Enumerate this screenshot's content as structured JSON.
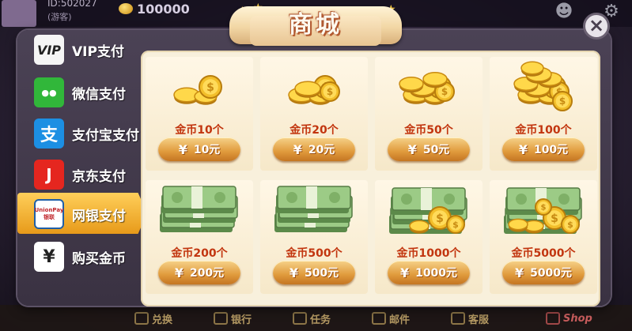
{
  "account": {
    "id": "ID:502027",
    "note": "(游客)",
    "coins": "100000"
  },
  "title": "商城",
  "close_label": "×",
  "tabs": [
    {
      "label": "VIP支付",
      "icon": "vip-icon",
      "icon_text": "VIP"
    },
    {
      "label": "微信支付",
      "icon": "wechat-icon",
      "icon_text": "●●"
    },
    {
      "label": "支付宝支付",
      "icon": "alipay-icon",
      "icon_text": "支"
    },
    {
      "label": "京东支付",
      "icon": "jd-icon",
      "icon_text": "J"
    },
    {
      "label": "网银支付",
      "icon": "unionpay-icon",
      "icon_text": "UnionPay 银联"
    },
    {
      "label": "购买金币",
      "icon": "yen-icon",
      "icon_text": "¥"
    }
  ],
  "active_tab": 4,
  "products": [
    {
      "name": "金币10个",
      "price": "10元",
      "art": "coins"
    },
    {
      "name": "金币20个",
      "price": "20元",
      "art": "coins"
    },
    {
      "name": "金币50个",
      "price": "50元",
      "art": "coins"
    },
    {
      "name": "金币100个",
      "price": "100元",
      "art": "coins"
    },
    {
      "name": "金币200个",
      "price": "200元",
      "art": "cash"
    },
    {
      "name": "金币500个",
      "price": "500元",
      "art": "cash"
    },
    {
      "name": "金币1000个",
      "price": "1000元",
      "art": "cash-coins"
    },
    {
      "name": "金币5000个",
      "price": "5000元",
      "art": "cash-coins"
    }
  ],
  "yen_symbol": "¥",
  "bottom_nav": [
    {
      "label": "兑换",
      "icon": "exchange-icon"
    },
    {
      "label": "银行",
      "icon": "bank-icon"
    },
    {
      "label": "任务",
      "icon": "task-icon"
    },
    {
      "label": "邮件",
      "icon": "mail-icon"
    },
    {
      "label": "客服",
      "icon": "service-icon"
    },
    {
      "label": "Shop",
      "icon": "shop-icon"
    }
  ],
  "colors": {
    "accent": "#f0b33a",
    "price_text": "#c2350f",
    "panel": "#f8f0dc"
  }
}
